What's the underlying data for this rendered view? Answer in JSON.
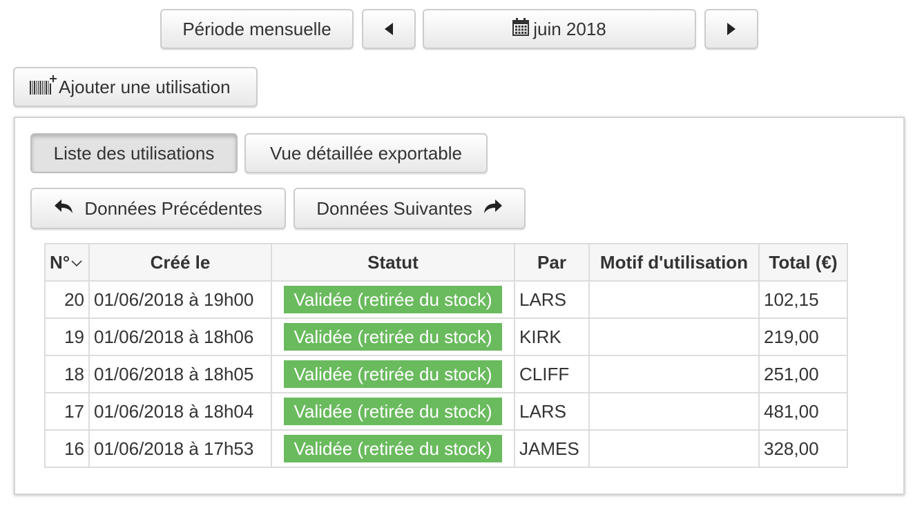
{
  "toolbar": {
    "period_label": "Période mensuelle",
    "month_label": "juin 2018",
    "prev_icon": "caret-left-icon",
    "next_icon": "caret-right-icon",
    "calendar_icon": "calendar-icon"
  },
  "actions": {
    "add_usage_label": "Ajouter une utilisation",
    "add_usage_icon": "barcode-plus-icon"
  },
  "tabs": [
    {
      "label": "Liste des utilisations",
      "active": true
    },
    {
      "label": "Vue détaillée exportable",
      "active": false
    }
  ],
  "pager": {
    "prev_label": "Données Précédentes",
    "next_label": "Données Suivantes"
  },
  "table": {
    "columns": [
      "N°",
      "Créé le",
      "Statut",
      "Par",
      "Motif d'utilisation",
      "Total (€)"
    ],
    "rows": [
      {
        "num": "20",
        "date": "01/06/2018 à 19h00",
        "status": "Validée (retirée du stock)",
        "by": "LARS",
        "motif": "",
        "total": "102,15"
      },
      {
        "num": "19",
        "date": "01/06/2018 à 18h06",
        "status": "Validée (retirée du stock)",
        "by": "KIRK",
        "motif": "",
        "total": "219,00"
      },
      {
        "num": "18",
        "date": "01/06/2018 à 18h05",
        "status": "Validée (retirée du stock)",
        "by": "CLIFF",
        "motif": "",
        "total": "251,00"
      },
      {
        "num": "17",
        "date": "01/06/2018 à 18h04",
        "status": "Validée (retirée du stock)",
        "by": "LARS",
        "motif": "",
        "total": "481,00"
      },
      {
        "num": "16",
        "date": "01/06/2018 à 17h53",
        "status": "Validée (retirée du stock)",
        "by": "JAMES",
        "motif": "",
        "total": "328,00"
      }
    ]
  },
  "colors": {
    "status_badge": "#6aba5e",
    "border": "#dcdcdc"
  }
}
